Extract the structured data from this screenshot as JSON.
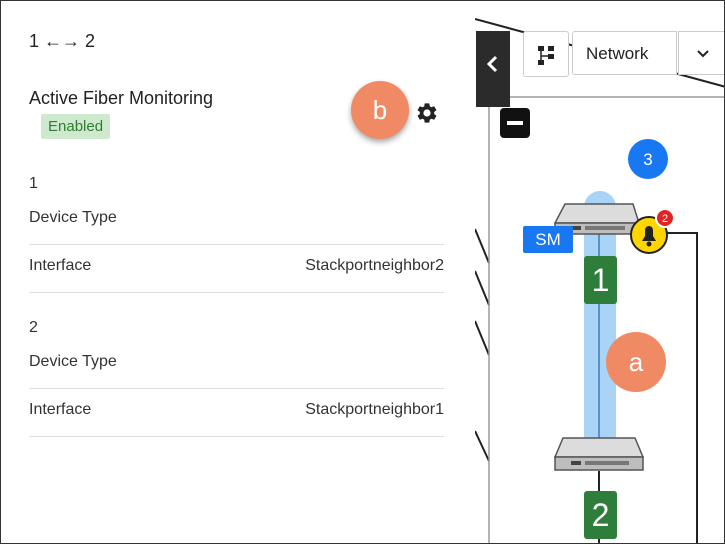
{
  "panel": {
    "link_title": "1 ←→ 2",
    "afm_title": "Active Fiber Monitoring",
    "afm_status": "Enabled",
    "callout_b": "b",
    "sections": [
      {
        "heading": "1",
        "device_type_label": "Device Type",
        "device_type_value": "",
        "interface_label": "Interface",
        "interface_value": "Stackportneighbor2"
      },
      {
        "heading": "2",
        "device_type_label": "Device Type",
        "device_type_value": "",
        "interface_label": "Interface",
        "interface_value": "Stackportneighbor1"
      }
    ]
  },
  "map": {
    "network_select": "Network",
    "group_count": "3",
    "sm_label": "SM",
    "alert_count": "2",
    "node1_label": "1",
    "node2_label": "2",
    "callout_a": "a"
  },
  "colors": {
    "badge_bg": "#cfe9cf",
    "badge_text": "#2e7d32",
    "callout": "#f08a64",
    "link_highlight": "#a9d4f5",
    "node_label": "#2e7d3a",
    "group_circle": "#1877f2",
    "alert_bell": "#ffd600",
    "alert_badge": "#e02424"
  },
  "icons": [
    "gear-icon",
    "chevron-left-icon",
    "topology-icon",
    "chevron-down-icon",
    "minus-icon",
    "bell-icon",
    "switch-icon"
  ]
}
